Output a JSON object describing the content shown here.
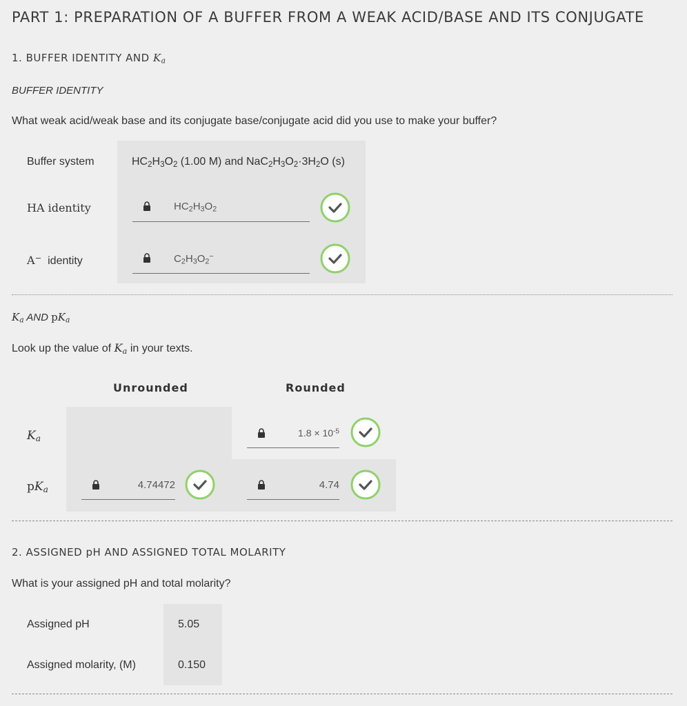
{
  "part": {
    "title": "PART 1: PREPARATION OF A BUFFER FROM A WEAK ACID/BASE AND ITS CONJUGATE"
  },
  "section1": {
    "title_prefix": "1. BUFFER IDENTITY AND ",
    "title_ka_K": "K",
    "title_ka_a": "a",
    "subhead": "BUFFER IDENTITY",
    "question": "What weak acid/weak base and its conjugate base/conjugate acid did you use to make your buffer?",
    "buffer_system_label": "Buffer system",
    "buffer_system_value": "HC2H3O2 (1.00 M) and NaC2H3O2·3H2O (s)",
    "ha_label": "HA identity",
    "ha_value": "HC2H3O2",
    "a_label": "A⁻ identity",
    "a_value": "C2H3O2⁻"
  },
  "ka_section": {
    "subhead": "Ka AND pKa",
    "question": "Look up the value of Ka in your texts.",
    "col_unrounded": "Unrounded",
    "col_rounded": "Rounded",
    "row_ka_label": "Ka",
    "row_pka_label": "pKa",
    "ka_rounded": "1.8 × 10-5",
    "pka_unrounded": "4.74472",
    "pka_rounded": "4.74"
  },
  "section2": {
    "title": "2. ASSIGNED pH AND ASSIGNED TOTAL MOLARITY",
    "question": "What is your assigned pH and total molarity?",
    "ph_label": "Assigned pH",
    "ph_value": "5.05",
    "molarity_label": "Assigned molarity, (M)",
    "molarity_value": "0.150"
  },
  "colors": {
    "accent_blue": "#2f63c9",
    "check_green": "#8fd16a",
    "shade": "#e4e4e4"
  },
  "icons": [
    "lock-icon",
    "checkmark-circle-icon"
  ]
}
